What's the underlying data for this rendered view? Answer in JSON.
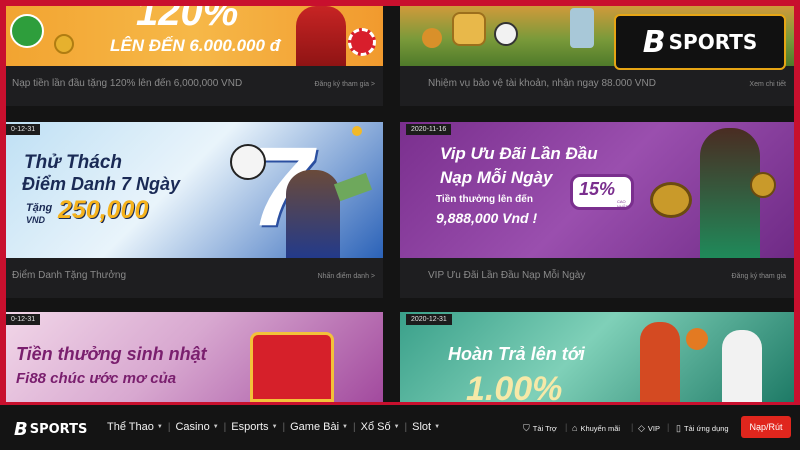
{
  "brand": {
    "logo_b": "B",
    "logo_text": "SPORTS"
  },
  "cards": [
    {
      "banner_line1": "120%",
      "banner_line2": "LÊN ĐẾN 6.000.000 đ",
      "title": "Nạp tiền lần đầu tặng 120% lên đến 6,000,000 VND",
      "link": "Đăng ký tham gia >"
    },
    {
      "title": "Nhiệm vụ bảo vệ tài khoản, nhận ngay 88.000 VND",
      "link": "Xem chi tiết"
    },
    {
      "date": "0-12-31",
      "banner_line1": "Thử Thách",
      "banner_line2": "Điểm Danh 7 Ngày",
      "banner_tang": "Tặng",
      "banner_vnd": "VND",
      "banner_amount": "250,000",
      "banner_seven": "7",
      "title": "Điểm Danh Tặng Thưởng",
      "link": "Nhấn điểm danh >"
    },
    {
      "date": "2020-11-16",
      "banner_line1": "Vip Ưu Đãi Lần Đầu",
      "banner_line2": "Nạp Mỗi Ngày",
      "banner_line3": "Tiền thưởng lên đến",
      "banner_line4": "9,888,000 Vnd !",
      "banner_pct": "15%",
      "banner_pct_sub": "CAO NHẤT",
      "title": "VIP Ưu Đãi Lần Đầu Nạp Mỗi Ngày",
      "link": "Đăng ký tham gia"
    },
    {
      "date": "0-12-31",
      "banner_line1": "Tiền thưởng sinh nhật",
      "banner_line2": "Fi88 chúc ước mơ của"
    },
    {
      "date": "2020-12-31",
      "banner_line1": "Hoàn Trả  lên tới",
      "banner_line2": "1.00%"
    }
  ],
  "nav": {
    "menu": [
      {
        "label": "Thể Thao"
      },
      {
        "label": "Casino"
      },
      {
        "label": "Esports"
      },
      {
        "label": "Game Bài"
      },
      {
        "label": "Xổ Số"
      },
      {
        "label": "Slot"
      }
    ],
    "utilities": [
      {
        "label": "Tài Trợ",
        "icon": "sponsor-icon"
      },
      {
        "label": "Khuyến mãi",
        "icon": "tag-icon"
      },
      {
        "label": "VIP",
        "icon": "diamond-icon"
      },
      {
        "label": "Tải ứng dụng",
        "icon": "phone-icon"
      }
    ],
    "deposit_label": "Nạp/Rút"
  },
  "colors": {
    "accent_red": "#c8102e",
    "badge_gold": "#e7a514",
    "deposit_red": "#e0261d"
  }
}
